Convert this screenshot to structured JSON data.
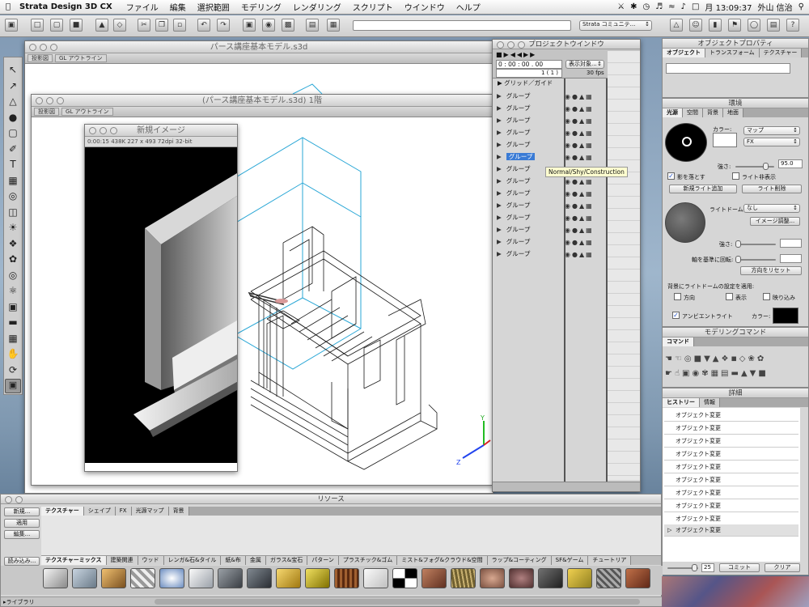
{
  "menubar": {
    "app": "Strata Design 3D CX",
    "items": [
      "ファイル",
      "編集",
      "選択範囲",
      "モデリング",
      "レンダリング",
      "スクリプト",
      "ウインドウ",
      "ヘルプ"
    ],
    "clock": "月 13:09:37",
    "user": "外山 信治"
  },
  "toolbar": {
    "community": "Strata コミュニテ..."
  },
  "main_window": {
    "title": "パース講座基本モデル.s3d",
    "view_label": "投影図",
    "render_mode": "GL アウトライン"
  },
  "second_window": {
    "title": "(パース講座基本モデル.s3d) 1階",
    "view_label": "投影図",
    "render_mode": "GL アウトライン"
  },
  "render_window": {
    "title": "新規イメージ",
    "info": "0:00:15  438K  227 x 493  72dpi  32-bit"
  },
  "project_window": {
    "title": "プロジェクトウインドウ",
    "timecode": "0 : 00 : 00 . 00",
    "frame": "1 ( 1 )",
    "display": "表示対象...",
    "fps": "30 fps",
    "guides": "グリッド／ガイド",
    "groups": [
      "グループ",
      "グループ",
      "グループ",
      "グループ",
      "グループ",
      "グループ",
      "グループ",
      "グループ",
      "グループ",
      "グループ",
      "グループ",
      "グループ",
      "グループ",
      "グループ"
    ],
    "tooltip": "Normal/Shy/Construction"
  },
  "object_props": {
    "title": "オブジェクトプロパティ",
    "tabs": [
      "オブジェクト",
      "トランスフォーム",
      "テクスチャー"
    ]
  },
  "environment": {
    "title": "環境",
    "tabs": [
      "光源",
      "空間",
      "背景",
      "地面"
    ],
    "color_label": "カラー:",
    "map": "マップ",
    "fx": "FX",
    "strength_label": "強さ:",
    "strength": "95.0",
    "cast_shadow": "影を落とす",
    "hide_light": "ライト非表示",
    "add_light": "新規ライト追加",
    "delete_light": "ライト削除",
    "light_dome_label": "ライトドーム:",
    "light_dome": "なし",
    "image_adjust": "イメージ調整...",
    "strength2_label": "強さ:",
    "rotate_label": "軸を基準に回転:",
    "reset_dir": "方向をリセット",
    "apply_bg_label": "背景にライトドームの設定を適用:",
    "opt_dir": "方向",
    "opt_show": "表示",
    "opt_reflect": "映り込み",
    "ambient": "アンビエントライト",
    "ambient_color": "カラー:"
  },
  "modeling_cmd": {
    "title": "モデリングコマンド",
    "tab": "コマンド"
  },
  "details": {
    "title": "詳細",
    "tabs": [
      "ヒストリー",
      "情報"
    ],
    "history": [
      "オブジェクト変更",
      "オブジェクト変更",
      "オブジェクト変更",
      "オブジェクト変更",
      "オブジェクト変更",
      "オブジェクト変更",
      "オブジェクト変更",
      "オブジェクト変更",
      "オブジェクト変更",
      "オブジェクト変更"
    ],
    "count": "25",
    "commit": "コミット",
    "clear": "クリア"
  },
  "resources": {
    "title": "リソース",
    "new": "新規...",
    "apply": "適用",
    "edit": "編集...",
    "load": "読み込み...",
    "library": "ライブラリ",
    "tabs": [
      "テクスチャー",
      "シェイプ",
      "FX",
      "光源マップ",
      "背景"
    ],
    "cats": [
      "テクスチャーミックス",
      "建築関連",
      "ウッド",
      "レンガ&石&タイル",
      "紙&布",
      "金属",
      "ガラス&宝石",
      "パターン",
      "プラスチック&ゴム",
      "ミスト&フォグ&クラウド&空間",
      "ラップ&コーティング",
      "SF&ゲーム",
      "チュートリア"
    ]
  },
  "colors": {
    "selection": "#3a7bd5",
    "wire": "#2aa7d6"
  }
}
